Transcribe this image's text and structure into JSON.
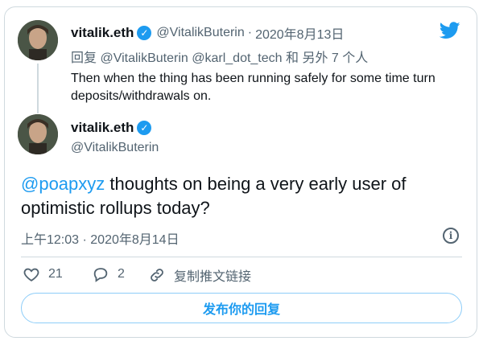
{
  "parent_tweet": {
    "display_name": "vitalik.eth",
    "handle": "@VitalikButerin",
    "separator": "·",
    "date": "2020年8月13日",
    "reply_prefix": "回复",
    "reply_to": "@VitalikButerin @karl_dot_tech",
    "reply_suffix": "和 另外 7 个人",
    "text": "Then when the thing has been running safely for some time turn deposits/withdrawals on."
  },
  "main_tweet": {
    "display_name": "vitalik.eth",
    "handle": "@VitalikButerin",
    "mention": "@poapxyz",
    "text": " thoughts on being a very early user of optimistic rollups today?",
    "time": "上午12:03",
    "separator": "·",
    "date": "2020年8月14日",
    "info_label": "i"
  },
  "actions": {
    "like_count": "21",
    "reply_count": "2",
    "copy_link_label": "复制推文链接"
  },
  "reply_button_label": "发布你的回复",
  "icons": {
    "verified": "verified-badge-icon",
    "twitter": "twitter-bird-icon",
    "like": "heart-icon",
    "reply": "comment-icon",
    "link": "link-icon",
    "info": "info-icon"
  },
  "colors": {
    "accent": "#1d9bf0",
    "muted": "#536471",
    "border": "#cfd9de"
  }
}
